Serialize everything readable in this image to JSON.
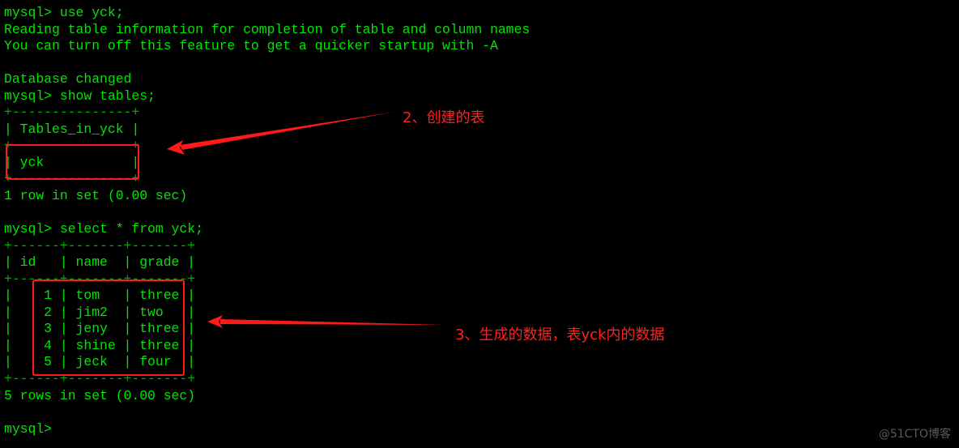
{
  "terminal": {
    "lines": [
      {
        "type": "cmd",
        "text": "mysql> use yck;"
      },
      {
        "type": "out",
        "text": "Reading table information for completion of table and column names"
      },
      {
        "type": "out",
        "text": "You can turn off this feature to get a quicker startup with -A"
      },
      {
        "type": "out",
        "text": ""
      },
      {
        "type": "out",
        "text": "Database changed"
      },
      {
        "type": "cmd",
        "text": "mysql> show tables;"
      },
      {
        "type": "border",
        "text": "+---------------+"
      },
      {
        "type": "header",
        "text": "| Tables_in_yck |"
      },
      {
        "type": "border",
        "text": "+---------------+"
      },
      {
        "type": "row",
        "text": "| yck           |"
      },
      {
        "type": "border",
        "text": "+---------------+"
      },
      {
        "type": "out",
        "text": "1 row in set (0.00 sec)"
      },
      {
        "type": "out",
        "text": ""
      },
      {
        "type": "cmd",
        "text": "mysql> select * from yck;"
      },
      {
        "type": "border",
        "text": "+------+-------+-------+"
      },
      {
        "type": "header",
        "text": "| id   | name  | grade |"
      },
      {
        "type": "border",
        "text": "+------+-------+-------+"
      },
      {
        "type": "row",
        "text": "|    1 | tom   | three |"
      },
      {
        "type": "row",
        "text": "|    2 | jim2  | two   |"
      },
      {
        "type": "row",
        "text": "|    3 | jeny  | three |"
      },
      {
        "type": "row",
        "text": "|    4 | shine | three |"
      },
      {
        "type": "row",
        "text": "|    5 | jeck  | four  |"
      },
      {
        "type": "border",
        "text": "+------+-------+-------+"
      },
      {
        "type": "out",
        "text": "5 rows in set (0.00 sec)"
      },
      {
        "type": "out",
        "text": ""
      },
      {
        "type": "cmd",
        "text": "mysql> "
      }
    ]
  },
  "tables_result": {
    "columns": [
      "Tables_in_yck"
    ],
    "rows": [
      [
        "yck"
      ]
    ],
    "summary": "1 row in set (0.00 sec)"
  },
  "yck_result": {
    "columns": [
      "id",
      "name",
      "grade"
    ],
    "rows": [
      [
        "1",
        "tom",
        "three"
      ],
      [
        "2",
        "jim2",
        "two"
      ],
      [
        "3",
        "jeny",
        "three"
      ],
      [
        "4",
        "shine",
        "three"
      ],
      [
        "5",
        "jeck",
        "four"
      ]
    ],
    "summary": "5 rows in set (0.00 sec)"
  },
  "annotations": {
    "note_tables": "2、创建的表",
    "note_data": "3、生成的数据，表yck内的数据",
    "color": "#ff1a1a"
  },
  "watermark": "@51CTO博客"
}
